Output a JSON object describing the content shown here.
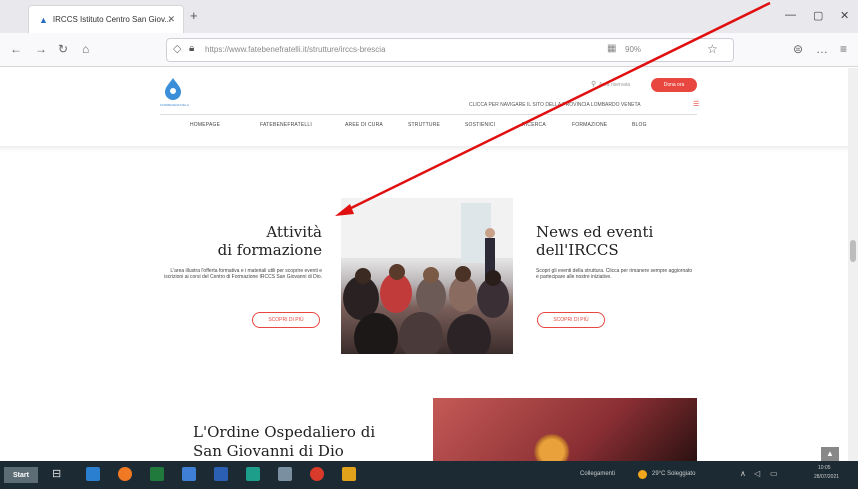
{
  "browser": {
    "tab_title": "IRCCS Istituto Centro San Giov...",
    "url": "https://www.fatebenefratelli.it/strutture/irccs-brescia",
    "zoom": "90%",
    "new_tab_symbol": "+"
  },
  "site": {
    "logo_sub": "FATEBENEFRATELLI",
    "area_link": "Area riservata",
    "donate_label": "Dona ora",
    "region_text": "CLICCA PER NAVIGARE IL SITO DELLA PROVINCIA LOMBARDO VENETA",
    "menu": [
      "HOMEPAGE",
      "FATEBENEFRATELLI",
      "AREE DI CURA",
      "STRUTTURE",
      "SOSTIENICI",
      "RICERCA",
      "FORMAZIONE",
      "BLOG"
    ]
  },
  "attivita": {
    "title_line1": "Attività",
    "title_line2": "di formazione",
    "text": "L'area illustra l'offerta formativa e i materiali utili per scoprire eventi e iscrizioni ai corsi del Centro di Formazione IRCCS San Giovanni di Dio.",
    "button": "SCOPRI DI PIÙ"
  },
  "news": {
    "title_line1": "News ed eventi",
    "title_line2": "dell'IRCCS",
    "text": "Scopri gli eventi della struttura. Clicca per rimanere sempre aggiornato e partecipare alle nostre iniziative.",
    "button": "SCOPRI DI PIÙ"
  },
  "ordine": {
    "title_line1": "L'Ordine Ospedaliero di",
    "title_line2": "San Giovanni di Dio"
  },
  "taskbar": {
    "start_label": "Start",
    "network": "Collegamenti",
    "weather": "29°C Soleggiato",
    "time": "10:05",
    "date": "28/07/2021"
  },
  "colors": {
    "accent": "#e8473f",
    "annotation_arrow": "#e01010",
    "taskbar": "#1c2b33"
  }
}
